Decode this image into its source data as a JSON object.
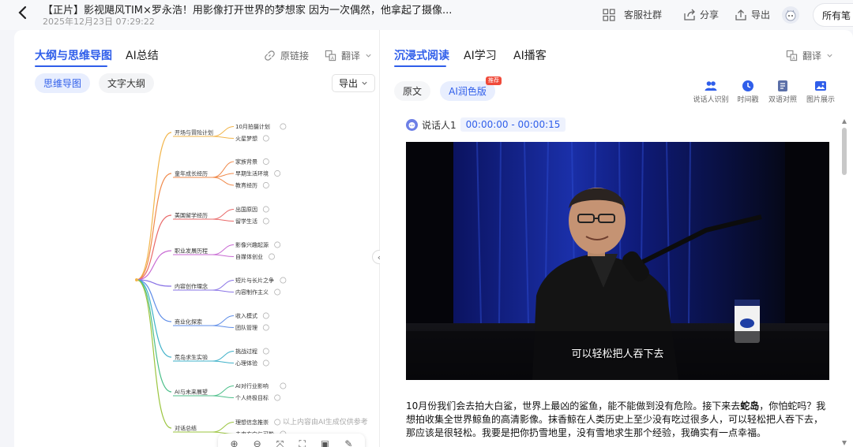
{
  "header": {
    "title": "【正片】影视飓风TIM×罗永浩！用影像打开世界的梦想家 因为一次偶然，他拿起了摄像...",
    "date": "2025年12月23日 07:29:22",
    "actions": {
      "service": "客服社群",
      "share": "分享",
      "export": "导出",
      "all": "所有笔"
    }
  },
  "left": {
    "tabs": [
      "大纲与思维导图",
      "AI总结"
    ],
    "links": {
      "original": "原链接",
      "translate": "翻译"
    },
    "pills": [
      "思维导图",
      "文字大纲"
    ],
    "export": "导出",
    "ai_note": "以上内容由AI生成仅供参考",
    "mindmap": {
      "branches": [
        {
          "label": "开场与冒险计划",
          "children": [
            "10月拍摄计划",
            "火星梦想"
          ]
        },
        {
          "label": "童年成长经历",
          "children": [
            "家族背景",
            "早期生活环境",
            "教育经历"
          ]
        },
        {
          "label": "美国留学经历",
          "children": [
            "出国原因",
            "留学生活"
          ]
        },
        {
          "label": "职业发展历程",
          "children": [
            "影像兴趣起源",
            "自媒体创业"
          ]
        },
        {
          "label": "内容创作理念",
          "children": [
            "短片与长片之争",
            "内容制作主义"
          ]
        },
        {
          "label": "商业化探索",
          "children": [
            "收入模式",
            "团队管理"
          ]
        },
        {
          "label": "荒岛求生实验",
          "children": [
            "挑战过程",
            "心理体验"
          ]
        },
        {
          "label": "AI与未来展望",
          "children": [
            "AI对行业影响",
            "个人终极目标"
          ]
        },
        {
          "label": "对话总结",
          "children": [
            "理想信念推崇",
            "未来方向与可能"
          ]
        }
      ]
    }
  },
  "right": {
    "tabs": [
      "沉浸式阅读",
      "AI学习",
      "AI播客"
    ],
    "translate": "翻译",
    "pills": [
      "原文",
      "AI润色版"
    ],
    "badge": "推荐",
    "tools": [
      "说话人识别",
      "时间戳",
      "双语对照",
      "图片展示"
    ],
    "speaker": "说话人1",
    "timestamp": "00:00:00 - 00:00:15",
    "subtitle": "可以轻松把人吞下去",
    "para": {
      "p1": "10月份我们会去拍大白鲨，世界上最凶的鲨鱼，能不能做到没有危险。接下来去",
      "bold": "蛇岛",
      "p2": "，你怕蛇吗？我想拍收集全世界鲸鱼的高清影像。抹香鲸在人类历史上至少没有吃过很多人，可以轻松把人吞下去，那应该是很轻松。我要是把你扔雪地里，没有雪地求生那个经验，我确实有一点幸福。"
    }
  },
  "colors": {
    "accent": "#2f5eea",
    "badge": "#f04a3a"
  }
}
